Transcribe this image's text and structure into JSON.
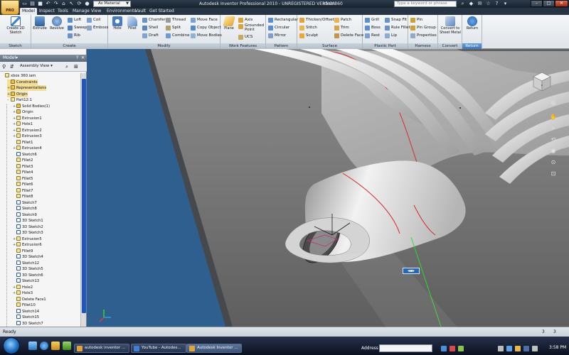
{
  "title_bar": {
    "app_button_label": "PRO",
    "material": "As Material",
    "window_title": "Autodesk Inventor Professional 2010 - UNREGISTERED VERSION",
    "document": "xbox 360",
    "search_placeholder": "Type a keyword or phrase"
  },
  "ribbon_tabs": [
    "Model",
    "Inspect",
    "Tools",
    "Manage",
    "View",
    "Environments",
    "Vault",
    "Get Started"
  ],
  "ribbon": {
    "sketch": {
      "footer": "Sketch",
      "create_2d_sketch": "Create 2D Sketch"
    },
    "create": {
      "footer": "Create",
      "extrude": "Extrude",
      "revolve": "Revolve",
      "loft": "Loft",
      "sweep": "Sweep",
      "rib": "Rib",
      "coil": "Coil",
      "emboss": "Emboss"
    },
    "modify": {
      "footer": "Modify",
      "hole": "Hole",
      "fillet": "Fillet",
      "chamfer": "Chamfer",
      "shell": "Shell",
      "draft": "Draft",
      "thread": "Thread",
      "split": "Split",
      "combine": "Combine",
      "move_face": "Move Face",
      "copy_object": "Copy Object",
      "move_bodies": "Move Bodies"
    },
    "work_features": {
      "footer": "Work Features",
      "plane": "Plane",
      "axis": "Axis",
      "grounded_point": "Grounded Point",
      "ucs": "UCS"
    },
    "pattern": {
      "footer": "Pattern",
      "rectangular": "Rectangular",
      "circular": "Circular",
      "mirror": "Mirror"
    },
    "surface": {
      "footer": "Surface",
      "thicken_offset": "Thicken/Offset",
      "stitch": "Stitch",
      "sculpt": "Sculpt",
      "patch": "Patch",
      "trim": "Trim",
      "delete_face": "Delete Face"
    },
    "plastic_part": {
      "footer": "Plastic Part",
      "grill": "Grill",
      "boss": "Boss",
      "rest": "Rest",
      "snap_fit": "Snap Fit",
      "rule_fillet": "Rule Fillet",
      "lip": "Lip"
    },
    "harness": {
      "footer": "Harness",
      "pin": "Pin",
      "pin_group": "Pin Group",
      "properties": "Properties"
    },
    "convert": {
      "footer": "Convert",
      "convert_to_sheet_metal": "Convert to Sheet Metal"
    },
    "return": {
      "footer": "Return",
      "return": "Return"
    }
  },
  "browser": {
    "header": "Model",
    "assembly_view": "Assembly View",
    "tree": [
      {
        "label": "xbox 360.iam",
        "indent": 0,
        "exp": "",
        "icon": "feat"
      },
      {
        "label": "Constraints",
        "indent": 1,
        "exp": "",
        "icon": "folder",
        "highlight": true
      },
      {
        "label": "Representations",
        "indent": 1,
        "exp": "+",
        "icon": "folder",
        "highlight": true
      },
      {
        "label": "Origin",
        "indent": 1,
        "exp": "+",
        "icon": "folder",
        "highlight": true
      },
      {
        "label": "Part12:1",
        "indent": 1,
        "exp": "-",
        "icon": "feat"
      },
      {
        "label": "Solid Bodies(1)",
        "indent": 2,
        "exp": "+",
        "icon": "folder"
      },
      {
        "label": "Origin",
        "indent": 2,
        "exp": "+",
        "icon": "folder"
      },
      {
        "label": "Extrusion1",
        "indent": 2,
        "exp": "+",
        "icon": "feat"
      },
      {
        "label": "Hole1",
        "indent": 2,
        "exp": "+",
        "icon": "feat"
      },
      {
        "label": "Extrusion2",
        "indent": 2,
        "exp": "+",
        "icon": "feat"
      },
      {
        "label": "Extrusion3",
        "indent": 2,
        "exp": "+",
        "icon": "feat"
      },
      {
        "label": "Fillet1",
        "indent": 2,
        "exp": "",
        "icon": "feat"
      },
      {
        "label": "Extrusion4",
        "indent": 2,
        "exp": "+",
        "icon": "feat"
      },
      {
        "label": "Sketch6",
        "indent": 2,
        "exp": "",
        "icon": "sketch"
      },
      {
        "label": "Fillet2",
        "indent": 2,
        "exp": "",
        "icon": "feat"
      },
      {
        "label": "Fillet3",
        "indent": 2,
        "exp": "",
        "icon": "feat"
      },
      {
        "label": "Fillet4",
        "indent": 2,
        "exp": "",
        "icon": "feat"
      },
      {
        "label": "Fillet5",
        "indent": 2,
        "exp": "",
        "icon": "feat"
      },
      {
        "label": "Fillet6",
        "indent": 2,
        "exp": "",
        "icon": "feat"
      },
      {
        "label": "Fillet7",
        "indent": 2,
        "exp": "",
        "icon": "feat"
      },
      {
        "label": "Fillet8",
        "indent": 2,
        "exp": "",
        "icon": "feat"
      },
      {
        "label": "Sketch7",
        "indent": 2,
        "exp": "",
        "icon": "sketch"
      },
      {
        "label": "Sketch8",
        "indent": 2,
        "exp": "",
        "icon": "sketch"
      },
      {
        "label": "Sketch9",
        "indent": 2,
        "exp": "",
        "icon": "sketch"
      },
      {
        "label": "3D Sketch1",
        "indent": 2,
        "exp": "",
        "icon": "sketch"
      },
      {
        "label": "3D Sketch2",
        "indent": 2,
        "exp": "",
        "icon": "sketch"
      },
      {
        "label": "3D Sketch3",
        "indent": 2,
        "exp": "",
        "icon": "sketch"
      },
      {
        "label": "Extrusion5",
        "indent": 2,
        "exp": "+",
        "icon": "feat"
      },
      {
        "label": "Extrusion6",
        "indent": 2,
        "exp": "+",
        "icon": "feat"
      },
      {
        "label": "Fillet9",
        "indent": 2,
        "exp": "",
        "icon": "feat"
      },
      {
        "label": "3D Sketch4",
        "indent": 2,
        "exp": "",
        "icon": "sketch"
      },
      {
        "label": "Sketch12",
        "indent": 2,
        "exp": "",
        "icon": "sketch"
      },
      {
        "label": "3D Sketch5",
        "indent": 2,
        "exp": "",
        "icon": "sketch"
      },
      {
        "label": "3D Sketch6",
        "indent": 2,
        "exp": "",
        "icon": "sketch"
      },
      {
        "label": "Sketch13",
        "indent": 2,
        "exp": "",
        "icon": "sketch"
      },
      {
        "label": "Hole2",
        "indent": 2,
        "exp": "+",
        "icon": "feat"
      },
      {
        "label": "Hole3",
        "indent": 2,
        "exp": "+",
        "icon": "feat"
      },
      {
        "label": "Delete Face1",
        "indent": 2,
        "exp": "",
        "icon": "feat"
      },
      {
        "label": "Fillet10",
        "indent": 2,
        "exp": "",
        "icon": "feat"
      },
      {
        "label": "Sketch14",
        "indent": 2,
        "exp": "",
        "icon": "sketch"
      },
      {
        "label": "Sketch15",
        "indent": 2,
        "exp": "",
        "icon": "sketch"
      },
      {
        "label": "3D Sketch7",
        "indent": 2,
        "exp": "",
        "icon": "sketch"
      }
    ]
  },
  "status": {
    "text": "Ready",
    "num1": "3",
    "num2": "3"
  },
  "taskbar": {
    "items": [
      "autodesk inventor ...",
      "YouTube - Autodes...",
      "Autodesk Inventor ..."
    ],
    "address_label": "Address",
    "clock": "3:58 PM"
  },
  "colors": {
    "viewport_bg": "#606060",
    "blue_face": "#2e5f8e",
    "part_grey": "#b3b3b3",
    "edge_red": "#d32a2a",
    "axis_green": "#39d52a"
  }
}
